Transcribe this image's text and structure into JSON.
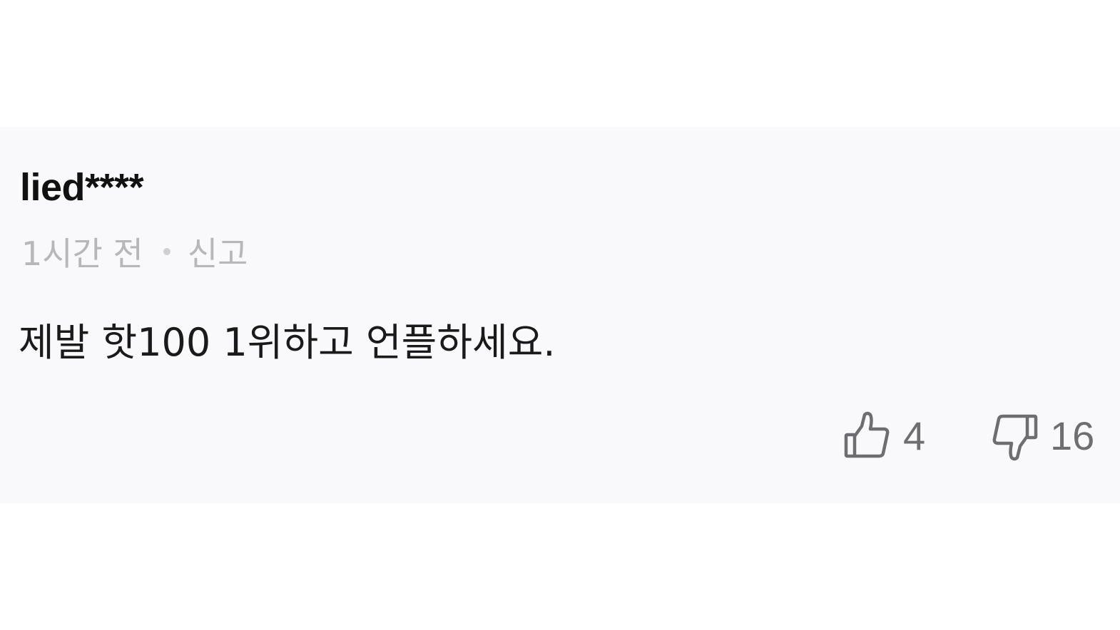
{
  "comment": {
    "username": "lied****",
    "time_ago": "1시간 전",
    "report_label": "신고",
    "body": "제발 핫100 1위하고 언플하세요.",
    "likes": "4",
    "dislikes": "16"
  },
  "icons": {
    "like": "thumbs-up-icon",
    "dislike": "thumbs-down-icon"
  },
  "colors": {
    "card_background": "#f9f9fb",
    "meta_text": "#b7b7bb",
    "reaction_gray": "#6e6e72"
  }
}
